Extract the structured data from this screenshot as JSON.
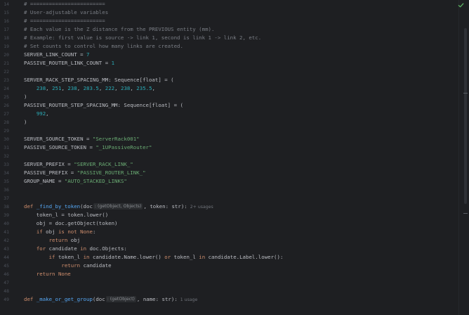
{
  "editor": {
    "lines": [
      {
        "n": "14",
        "t": [
          [
            "comment",
            "# ========================"
          ]
        ]
      },
      {
        "n": "15",
        "t": [
          [
            "comment",
            "# User-adjustable variables"
          ]
        ]
      },
      {
        "n": "16",
        "t": [
          [
            "comment",
            "# ========================"
          ]
        ]
      },
      {
        "n": "17",
        "t": [
          [
            "comment",
            "# Each value is the Z distance from the PREVIOUS entity (mm)."
          ]
        ]
      },
      {
        "n": "18",
        "t": [
          [
            "comment",
            "# Example: first value is source -> link 1, second is link 1 -> link 2, etc."
          ]
        ]
      },
      {
        "n": "19",
        "t": [
          [
            "comment",
            "# Set counts to control how many links are created."
          ]
        ]
      },
      {
        "n": "20",
        "t": [
          [
            "const",
            "SERVER_LINK_COUNT = "
          ],
          [
            "number",
            "7"
          ]
        ]
      },
      {
        "n": "21",
        "t": [
          [
            "const",
            "PASSIVE_ROUTER_LINK_COUNT = "
          ],
          [
            "number",
            "1"
          ]
        ]
      },
      {
        "n": "22",
        "t": []
      },
      {
        "n": "23",
        "t": [
          [
            "const",
            "SERVER_RACK_STEP_SPACING_MM: Sequence[float] = ("
          ]
        ]
      },
      {
        "n": "24",
        "t": [
          [
            "ident",
            "    "
          ],
          [
            "number",
            "238"
          ],
          [
            "ident",
            ", "
          ],
          [
            "number",
            "251"
          ],
          [
            "ident",
            ", "
          ],
          [
            "number",
            "238"
          ],
          [
            "ident",
            ", "
          ],
          [
            "number",
            "283.5"
          ],
          [
            "ident",
            ", "
          ],
          [
            "number",
            "222"
          ],
          [
            "ident",
            ", "
          ],
          [
            "number",
            "238"
          ],
          [
            "ident",
            ", "
          ],
          [
            "number",
            "235.5"
          ],
          [
            "ident",
            ","
          ]
        ]
      },
      {
        "n": "25",
        "t": [
          [
            "ident",
            ")"
          ]
        ]
      },
      {
        "n": "26",
        "t": [
          [
            "const",
            "PASSIVE_ROUTER_STEP_SPACING_MM: Sequence[float] = ("
          ]
        ]
      },
      {
        "n": "27",
        "t": [
          [
            "ident",
            "    "
          ],
          [
            "number",
            "992"
          ],
          [
            "ident",
            ","
          ]
        ]
      },
      {
        "n": "28",
        "t": [
          [
            "ident",
            ")"
          ]
        ]
      },
      {
        "n": "29",
        "t": []
      },
      {
        "n": "30",
        "t": [
          [
            "const",
            "SERVER_SOURCE_TOKEN = "
          ],
          [
            "string",
            "\"ServerRack001\""
          ]
        ]
      },
      {
        "n": "31",
        "t": [
          [
            "const",
            "PASSIVE_SOURCE_TOKEN = "
          ],
          [
            "string",
            "\"_1UPassiveRouter\""
          ]
        ]
      },
      {
        "n": "32",
        "t": []
      },
      {
        "n": "33",
        "t": [
          [
            "const",
            "SERVER_PREFIX = "
          ],
          [
            "string",
            "\"SERVER_RACK_LINK_\""
          ]
        ]
      },
      {
        "n": "34",
        "t": [
          [
            "const",
            "PASSIVE_PREFIX = "
          ],
          [
            "string",
            "\"PASSIVE_ROUTER_LINK_\""
          ]
        ]
      },
      {
        "n": "35",
        "t": [
          [
            "const",
            "GROUP_NAME = "
          ],
          [
            "string",
            "\"AUTO_STACKED_LINKS\""
          ]
        ]
      },
      {
        "n": "36",
        "t": []
      },
      {
        "n": "37",
        "t": []
      },
      {
        "n": "38",
        "t": [
          [
            "keyword",
            "def "
          ],
          [
            "fn",
            "_find_by_token"
          ],
          [
            "ident",
            "(doc"
          ],
          [
            "hint",
            ": (getObject, Objects)"
          ],
          [
            "ident",
            ", token: str):"
          ],
          [
            "usage",
            "2+ usages"
          ]
        ]
      },
      {
        "n": "39",
        "t": [
          [
            "ident",
            "    token_l = token.lower()"
          ]
        ]
      },
      {
        "n": "40",
        "t": [
          [
            "ident",
            "    obj = doc.getObject(token)"
          ]
        ]
      },
      {
        "n": "41",
        "t": [
          [
            "ident",
            "    "
          ],
          [
            "keyword",
            "if "
          ],
          [
            "ident",
            "obj "
          ],
          [
            "keyword",
            "is not None"
          ],
          [
            "ident",
            ":"
          ]
        ]
      },
      {
        "n": "42",
        "t": [
          [
            "ident",
            "        "
          ],
          [
            "keyword",
            "return "
          ],
          [
            "ident",
            "obj"
          ]
        ]
      },
      {
        "n": "43",
        "t": [
          [
            "ident",
            "    "
          ],
          [
            "keyword",
            "for "
          ],
          [
            "ident",
            "candidate "
          ],
          [
            "keyword",
            "in "
          ],
          [
            "ident",
            "doc.Objects:"
          ]
        ]
      },
      {
        "n": "44",
        "t": [
          [
            "ident",
            "        "
          ],
          [
            "keyword",
            "if "
          ],
          [
            "ident",
            "token_l "
          ],
          [
            "keyword",
            "in "
          ],
          [
            "ident",
            "candidate.Name.lower() "
          ],
          [
            "keyword",
            "or "
          ],
          [
            "ident",
            "token_l "
          ],
          [
            "keyword",
            "in "
          ],
          [
            "ident",
            "candidate.Label.lower():"
          ]
        ]
      },
      {
        "n": "45",
        "t": [
          [
            "ident",
            "            "
          ],
          [
            "keyword",
            "return "
          ],
          [
            "ident",
            "candidate"
          ]
        ]
      },
      {
        "n": "46",
        "t": [
          [
            "ident",
            "    "
          ],
          [
            "keyword",
            "return None"
          ]
        ]
      },
      {
        "n": "47",
        "t": []
      },
      {
        "n": "48",
        "t": []
      },
      {
        "n": "49",
        "t": [
          [
            "keyword",
            "def "
          ],
          [
            "fn",
            "_make_or_get_group"
          ],
          [
            "ident",
            "(doc"
          ],
          [
            "hint",
            ": (getObject)"
          ],
          [
            "ident",
            ", name: str):"
          ],
          [
            "usage",
            "1 usage"
          ]
        ]
      }
    ]
  },
  "status": {
    "check_icon": "check-icon",
    "check_color": "#5fb865"
  },
  "colors": {
    "background": "#1e1f22",
    "comment": "#7a7e85",
    "keyword": "#cf8e6d",
    "number": "#2aacb8",
    "string": "#6aab73",
    "function": "#56a8f5",
    "text": "#bcbec4"
  }
}
